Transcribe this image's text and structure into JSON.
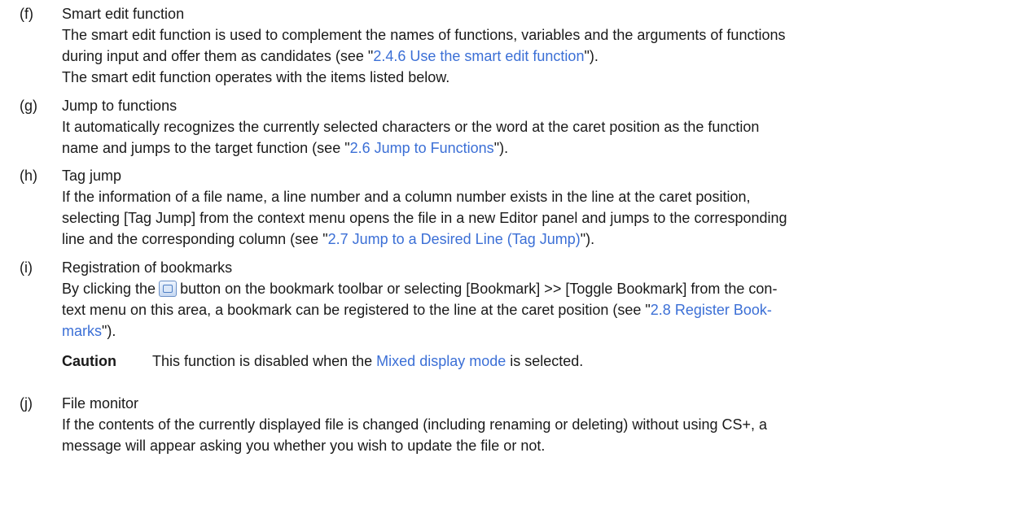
{
  "items": {
    "f": {
      "marker": "(f)",
      "title": "Smart edit function",
      "l1": "The smart edit function is used to complement the names of functions, variables and the arguments of functions",
      "l2_pre": "during input and offer them as candidates (see \"",
      "l2_link": "2.4.6  Use the smart edit function",
      "l2_post": "\").",
      "l3": "The smart edit function operates with the items listed below."
    },
    "g": {
      "marker": "(g)",
      "title": "Jump to functions",
      "l1": "It automatically recognizes the currently selected characters or the word at the caret position as the function",
      "l2_pre": "name and jumps to the target function (see \"",
      "l2_link": "2.6  Jump to Functions",
      "l2_post": "\")."
    },
    "h": {
      "marker": "(h)",
      "title": "Tag jump",
      "l1": "If the information of a file name, a line number and a column number exists in the line at the caret position,",
      "l2": "selecting [Tag Jump] from the context menu opens the file in a new Editor panel and jumps to the corresponding",
      "l3_pre": "line and the corresponding column (see \"",
      "l3_link": "2.7  Jump to a Desired Line (Tag Jump)",
      "l3_post": "\")."
    },
    "i": {
      "marker": "(i)",
      "title": "Registration of bookmarks",
      "l1_pre": "By clicking the",
      "l1_post": "button on the bookmark toolbar or selecting [Bookmark] >> [Toggle Bookmark] from the con-",
      "l2_pre": "text menu on this area, a bookmark can be registered to the line at the caret position (see \"",
      "l2_link": "2.8  Register Book-",
      "l3_link": "marks",
      "l3_post": "\").",
      "caution_label": "Caution",
      "caution_pre": "This function is disabled when the ",
      "caution_link": "Mixed display mode",
      "caution_post": " is selected."
    },
    "j": {
      "marker": "(j)",
      "title": "File monitor",
      "l1": "If the contents of the currently displayed file is changed (including renaming or deleting) without using CS+, a",
      "l2": "message will appear asking you whether you wish to update the file or not."
    }
  },
  "colors": {
    "link": "#3b6fd6",
    "text": "#1a1a1a"
  },
  "icons": {
    "bookmark_toggle": "bookmark-toggle-icon"
  }
}
